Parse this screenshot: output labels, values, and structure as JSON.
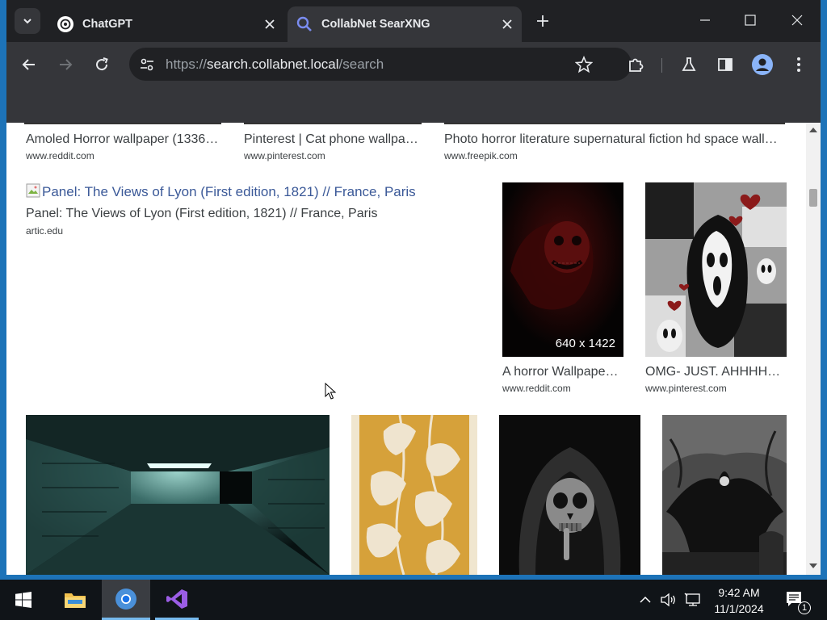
{
  "browser": {
    "tabs": [
      {
        "title": "ChatGPT",
        "active": false
      },
      {
        "title": "CollabNet SearXNG",
        "active": true
      }
    ],
    "url": {
      "prefix": "https://",
      "host": "search.collabnet.local",
      "path": "/search"
    }
  },
  "results_top": [
    {
      "caption": "Amoled Horror wallpaper (1336…",
      "source": "www.reddit.com"
    },
    {
      "caption": "Pinterest | Cat phone wallpa…",
      "source": "www.pinterest.com"
    },
    {
      "caption": "Photo horror literature supernatural fiction hd space wall…",
      "source": "www.freepik.com"
    }
  ],
  "broken_result": {
    "link_text": "Panel: The Views of Lyon (First edition, 1821) // France, Paris",
    "caption": "Panel: The Views of Lyon (First edition, 1821) // France, Paris",
    "source": "artic.edu"
  },
  "results_mid": [
    {
      "caption": "A horror Wallpape…",
      "source": "www.reddit.com",
      "dims": "640 x 1422"
    },
    {
      "caption": "OMG- JUST. AHHHH…",
      "source": "www.pinterest.com"
    }
  ],
  "taskbar": {
    "time": "9:42 AM",
    "date": "11/1/2024",
    "notification_count": "1"
  },
  "colors": {
    "accent": "#1d73b8",
    "link": "#3b5998"
  }
}
